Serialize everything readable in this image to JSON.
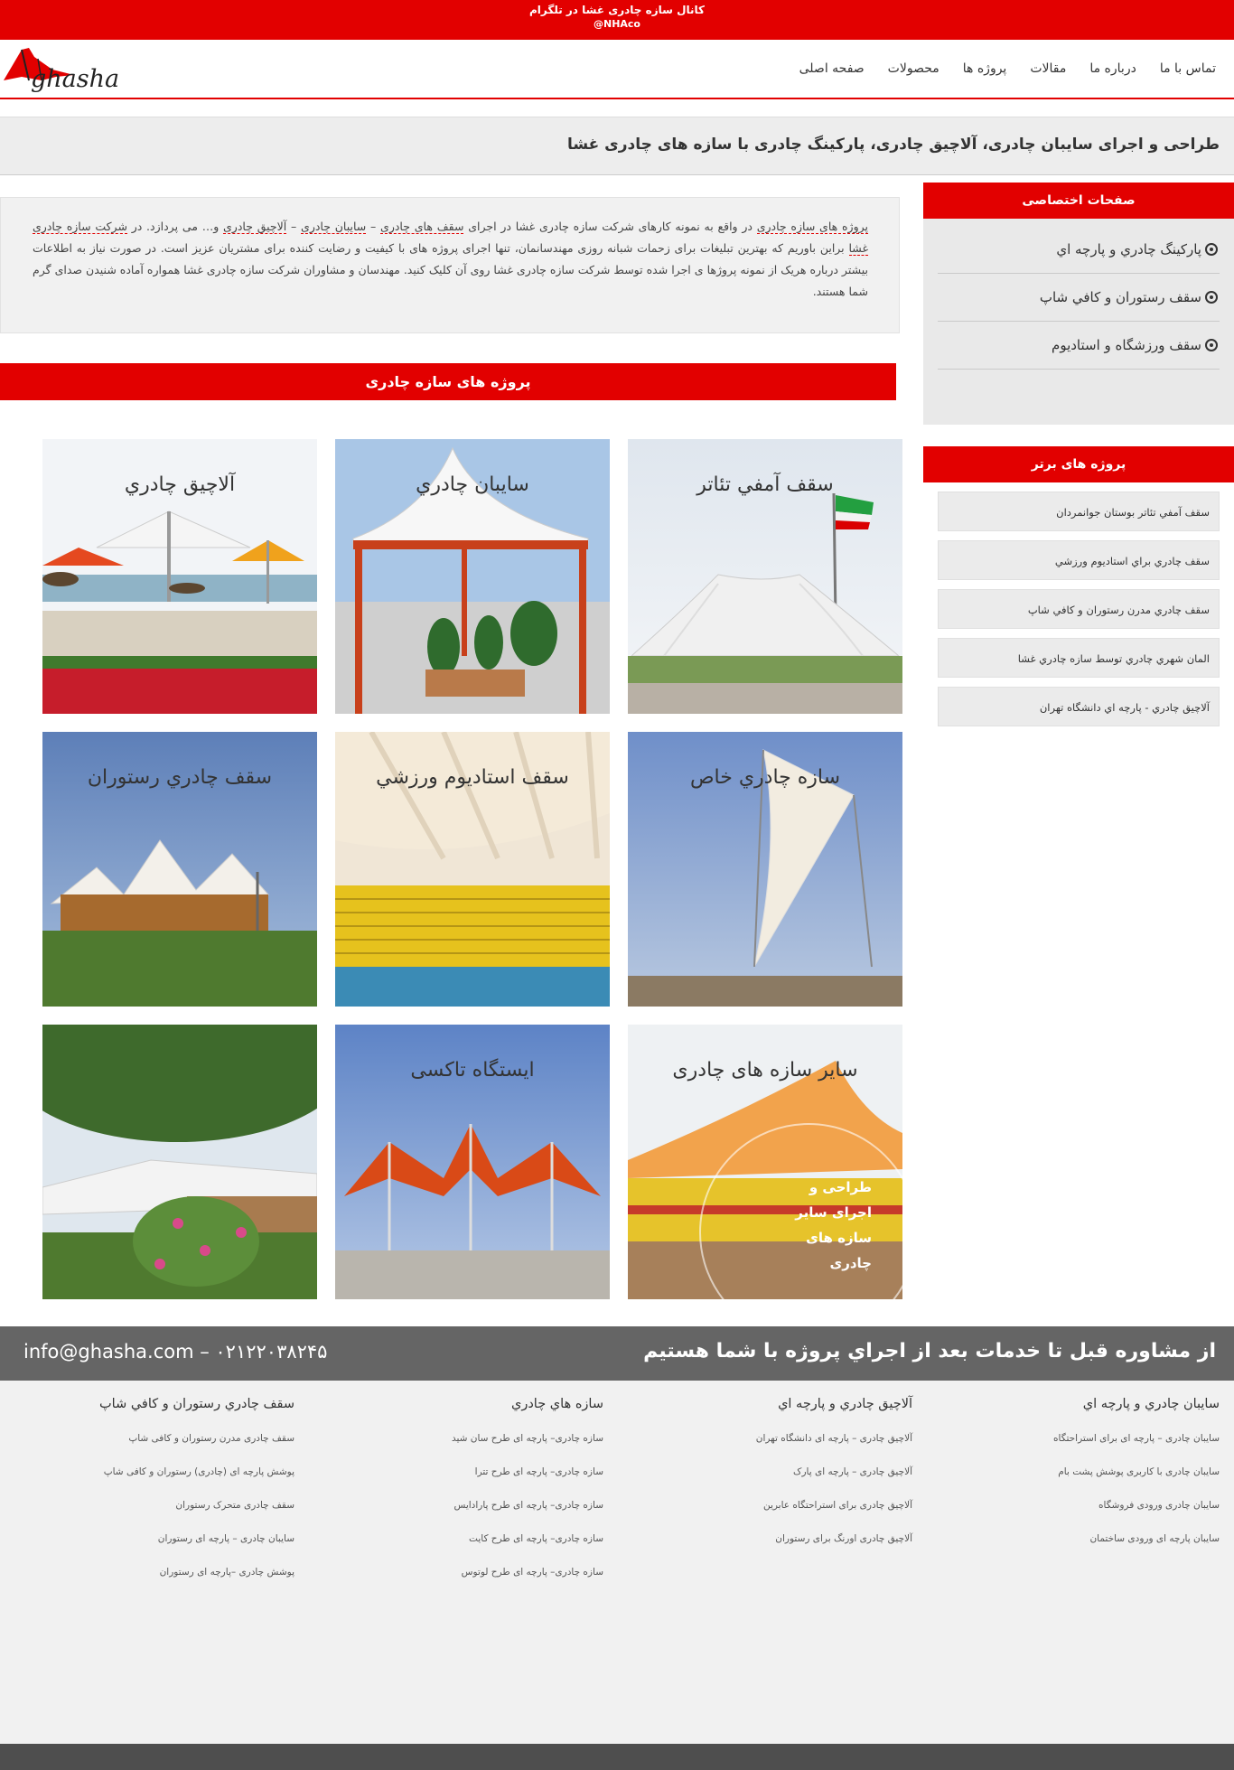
{
  "topbar": {
    "line1": "کانال سازه چادری غشا در تلگرام",
    "line2": "@NHAco"
  },
  "header": {
    "logo_text": "ghasha",
    "nav": [
      "صفحه اصلی",
      "محصولات",
      "پروژه ها",
      "مقالات",
      "درباره ما",
      "تماس با ما"
    ]
  },
  "page": {
    "title": "طراحی و اجرای سایبان چادری، آلاچیق چادری، پارکینگ چادری با سازه های چادری غشا"
  },
  "intro": {
    "kw1": "پروژه های سازه چادری",
    "t1": " در واقع به نمونه کارهای شرکت سازه چادری غشا در اجرای ",
    "kw2": "سقف های چادری",
    "t2": " – ",
    "kw3": "سایبان چادری",
    "t3": " – ",
    "kw4": "آلاچیق چادری",
    "t4": " و… می پردازد. در ",
    "kw5": "شرکت سازه چادری غشا",
    "t5": " براین باوریم که بهترین تبلیغات برای زحمات شبانه روزی مهندسانمان، تنها اجرای پروژه های با کیفیت و رضایت کننده برای مشتریان عزیز است. در صورت نیاز به اطلاعات بیشتر درباره هریک از نمونه پروژها ی اجرا شده توسط شرکت سازه چادری غشا روی آن کلیک کنید. مهندسان و مشاوران شرکت سازه چادری غشا همواره آماده شنیدن صدای گرم شما هستند."
  },
  "projects": {
    "heading": "پروژه های سازه چادری",
    "tiles": [
      {
        "caption": "سقف آمفي تئاتر"
      },
      {
        "caption": "سايبان چادري"
      },
      {
        "caption": "آلاچيق چادري"
      },
      {
        "caption": "سازه چادري خاص"
      },
      {
        "caption": "سقف استاديوم ورزشي"
      },
      {
        "caption": "سقف چادري رستوران"
      },
      {
        "caption": "ساير سازه های چادری"
      },
      {
        "caption": "ایستگاه تاکسی"
      },
      {
        "caption": ""
      }
    ],
    "tile7_overlay": [
      "طراحی و",
      "اجرای سایر",
      "سازه های",
      "چادری"
    ]
  },
  "sidebar": {
    "special_heading": "صفحات اختصاصی",
    "special_items": [
      "پارکينگ چادري و پارچه اي",
      "سقف رستوران و کافي شاپ",
      "سقف ورزشگاه و استاديوم"
    ],
    "top_heading": "پروژه های برتر",
    "top_items": [
      "سقف آمفي تئاتر بوستان جوانمردان",
      "سقف چادري براي استاديوم ورزشي",
      "سقف چادري مدرن رستوران و کافي شاپ",
      "المان شهري چادري توسط سازه چادري غشا",
      "آلاچيق چادري - پارچه اي دانشگاه تهران"
    ]
  },
  "contact": {
    "slogan": "از مشاوره قبل تا خدمات بعد از اجراي پروژه با شما هستيم",
    "info": "info@ghasha.com – ۰۲۱۲۲۰۳۸۲۴۵"
  },
  "footer": {
    "columns": [
      {
        "title": "سايبان چادري و پارچه اي",
        "links": [
          "سایبان چادری – پارچه ای برای استراحتگاه",
          "سایبان چادری با کاربری پوشش پشت بام",
          "سایبان چادری ورودی فروشگاه",
          "سایبان پارچه ای ورودی ساختمان"
        ]
      },
      {
        "title": "آلاچيق چادري و پارچه اي",
        "links": [
          "آلاچیق چادری – پارچه ای دانشگاه تهران",
          "آلاچیق چادری – پارچه ای پارک",
          "آلاچیق چادری برای استراحتگاه عابرین",
          "آلاچیق چادری اورنگ برای رستوران"
        ]
      },
      {
        "title": "سازه هاي چادري",
        "links": [
          "سازه چادری– پارچه ای طرح سان شید",
          "سازه چادری– پارچه ای طرح تترا",
          "سازه چادری– پارچه ای طرح پارادایس",
          "سازه چادری– پارچه ای طرح کایت",
          "سازه چادری– پارچه ای طرح لوتوس"
        ]
      },
      {
        "title": "سقف چادري رستوران و کافي شاپ",
        "links": [
          "سقف چادری مدرن رستوران و کافی شاپ",
          "پوشش پارچه ای (چادری) رستوران و کافی شاپ",
          "سقف چادری متحرک رستوران",
          "سایبان چادری – پارچه ای رستوران",
          "پوشش چادری –پارچه ای رستوران"
        ]
      }
    ]
  },
  "colors": {
    "brand_red": "#e20000",
    "contact_bar": "#656565"
  }
}
